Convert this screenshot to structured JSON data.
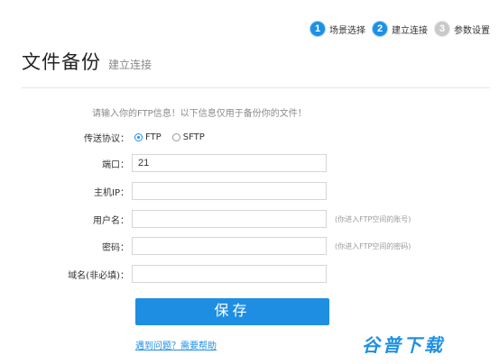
{
  "steps": [
    {
      "num": "1",
      "label": "场景选择"
    },
    {
      "num": "2",
      "label": "建立连接"
    },
    {
      "num": "3",
      "label": "参数设置"
    }
  ],
  "title": "文件备份",
  "subtitle": "建立连接",
  "hint": "请输入你的FTP信息！以下信息仅用于备份你的文件！",
  "form": {
    "protocol_label": "传送协议：",
    "protocol_options": [
      "FTP",
      "SFTP"
    ],
    "protocol_selected": "FTP",
    "port_label": "端口：",
    "port_value": "21",
    "host_label": "主机IP：",
    "host_value": "",
    "user_label": "用户名：",
    "user_value": "",
    "user_note": "(你进入FTP空间的账号)",
    "password_label": "密码：",
    "password_value": "",
    "password_note": "(你进入FTP空间的密码)",
    "domain_label": "域名(非必填)：",
    "domain_value": ""
  },
  "save_label": "保存",
  "help_link": "遇到问题？需要帮助",
  "watermark": "谷普下载",
  "colors": {
    "accent": "#1e8ee3",
    "inactive_step": "#c9c9c9"
  }
}
